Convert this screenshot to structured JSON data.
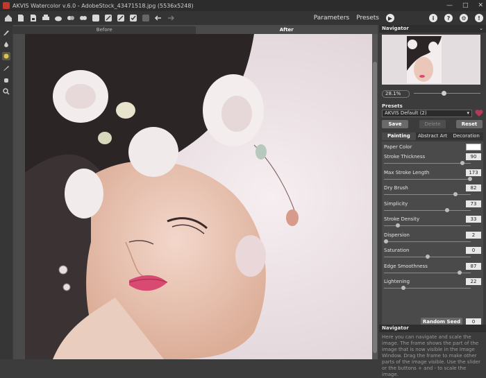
{
  "window": {
    "title": "AKVIS Watercolor v.6.0 - AdobeStock_43471518.jpg (5536x5248)"
  },
  "toolbar": {
    "parameters_label": "Parameters",
    "presets_label": "Presets",
    "icons": [
      "home-icon",
      "open-icon",
      "save-icon",
      "print-icon",
      "upload-icon",
      "batch-icon",
      "before-after-icon",
      "gear-brush-icon",
      "layers-icon",
      "stroke-icon",
      "brush-check-icon",
      "disabled-icon",
      "undo-icon",
      "redo-icon"
    ]
  },
  "canvas": {
    "tab_before": "Before",
    "tab_after": "After"
  },
  "navigator": {
    "title": "Navigator",
    "zoom": "28.1%",
    "zoom_position": 0.45
  },
  "presets": {
    "label": "Presets",
    "selected": "AKVIS Default (2)",
    "save_label": "Save",
    "delete_label": "Delete",
    "reset_label": "Reset"
  },
  "settings_tabs": [
    "Painting",
    "Abstract Art",
    "Decoration"
  ],
  "settings": {
    "paper_color_label": "Paper Color",
    "paper_color": "#ffffff",
    "params": [
      {
        "label": "Stroke Thickness",
        "value": "90",
        "pos": 0.9
      },
      {
        "label": "Max Stroke Length",
        "value": "173",
        "pos": 0.99
      },
      {
        "label": "Dry Brush",
        "value": "82",
        "pos": 0.82
      },
      {
        "label": "Simplicity",
        "value": "73",
        "pos": 0.73
      },
      {
        "label": "Stroke Density",
        "value": "33",
        "pos": 0.16
      },
      {
        "label": "Dispersion",
        "value": "2",
        "pos": 0.02
      },
      {
        "label": "Saturation",
        "value": "0",
        "pos": 0.5
      },
      {
        "label": "Edge Smoothness",
        "value": "87",
        "pos": 0.87
      },
      {
        "label": "Lightening",
        "value": "22",
        "pos": 0.22
      }
    ],
    "random_seed_label": "Random Seed",
    "random_seed_value": "0"
  },
  "help": {
    "title": "Navigator",
    "text": "Here you can navigate and scale the image. The frame shows the part of the image that is now visible in the Image Window. Drag the frame to make other parts of the image visible. Use the slider or the buttons + and - to scale the image."
  }
}
